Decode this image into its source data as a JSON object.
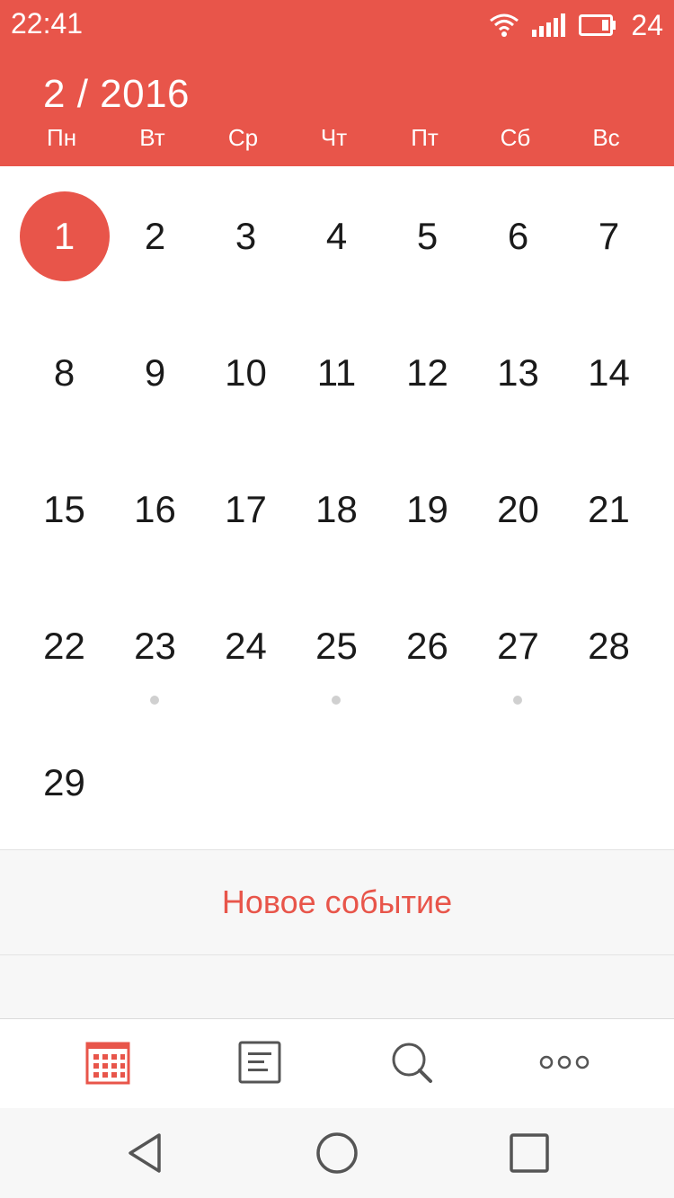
{
  "status_bar": {
    "time": "22:41",
    "battery_level": "24",
    "icons": [
      "wifi-icon",
      "signal-icon",
      "battery-icon"
    ]
  },
  "calendar": {
    "month_title": "2 / 2016",
    "weekdays": [
      "Пн",
      "Вт",
      "Ср",
      "Чт",
      "Пт",
      "Сб",
      "Вс"
    ],
    "selected_day": "1",
    "days": [
      "1",
      "2",
      "3",
      "4",
      "5",
      "6",
      "7",
      "8",
      "9",
      "10",
      "11",
      "12",
      "13",
      "14",
      "15",
      "16",
      "17",
      "18",
      "19",
      "20",
      "21",
      "22",
      "23",
      "24",
      "25",
      "26",
      "27",
      "28",
      "29"
    ],
    "days_with_events": [
      "23",
      "25",
      "27"
    ]
  },
  "new_event": {
    "label": "Новое событие"
  },
  "tabbar": {
    "items": [
      "calendar-icon",
      "agenda-list-icon",
      "search-icon",
      "more-icon"
    ],
    "active": "calendar-icon"
  },
  "navbar": {
    "items": [
      "back-icon",
      "home-icon",
      "recents-icon"
    ]
  },
  "colors": {
    "accent": "#e8554a",
    "text": "#1a1a1a",
    "event_dot": "#d0d0d0",
    "icon_gray": "#555555"
  }
}
